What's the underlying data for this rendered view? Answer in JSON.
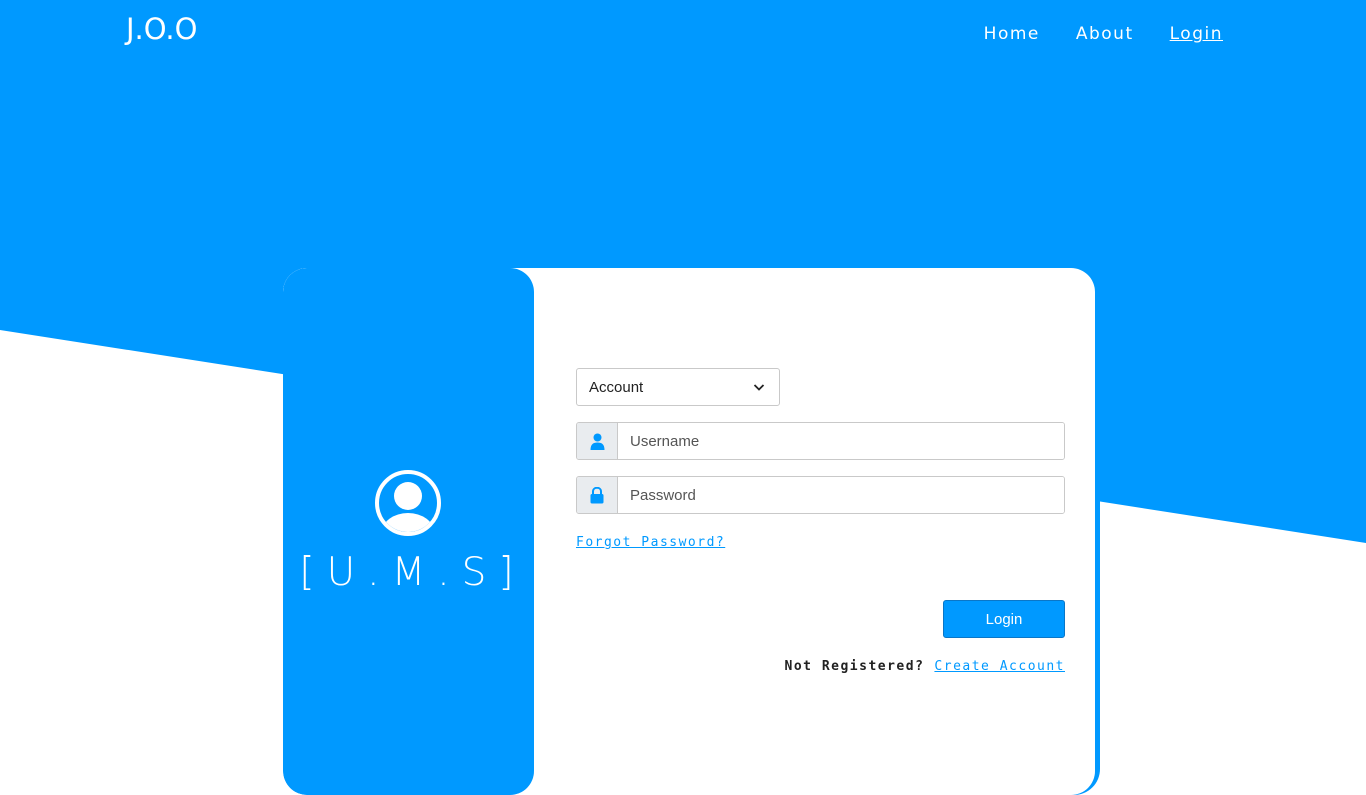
{
  "navbar": {
    "brand": "J.O.O",
    "links": [
      {
        "label": "Home"
      },
      {
        "label": "About"
      },
      {
        "label": "Login"
      }
    ]
  },
  "left_panel": {
    "icon": "user-circle-icon",
    "title": "[U.M.S]"
  },
  "form": {
    "account_select": {
      "selected": "Account"
    },
    "username": {
      "placeholder": "Username",
      "icon": "user-icon"
    },
    "password": {
      "placeholder": "Password",
      "icon": "lock-icon"
    },
    "forgot_label": "Forgot Password?",
    "login_label": "Login",
    "register_prompt": "Not Registered?",
    "register_link": "Create Account"
  },
  "colors": {
    "primary": "#0099ff",
    "background": "#ffffff"
  }
}
